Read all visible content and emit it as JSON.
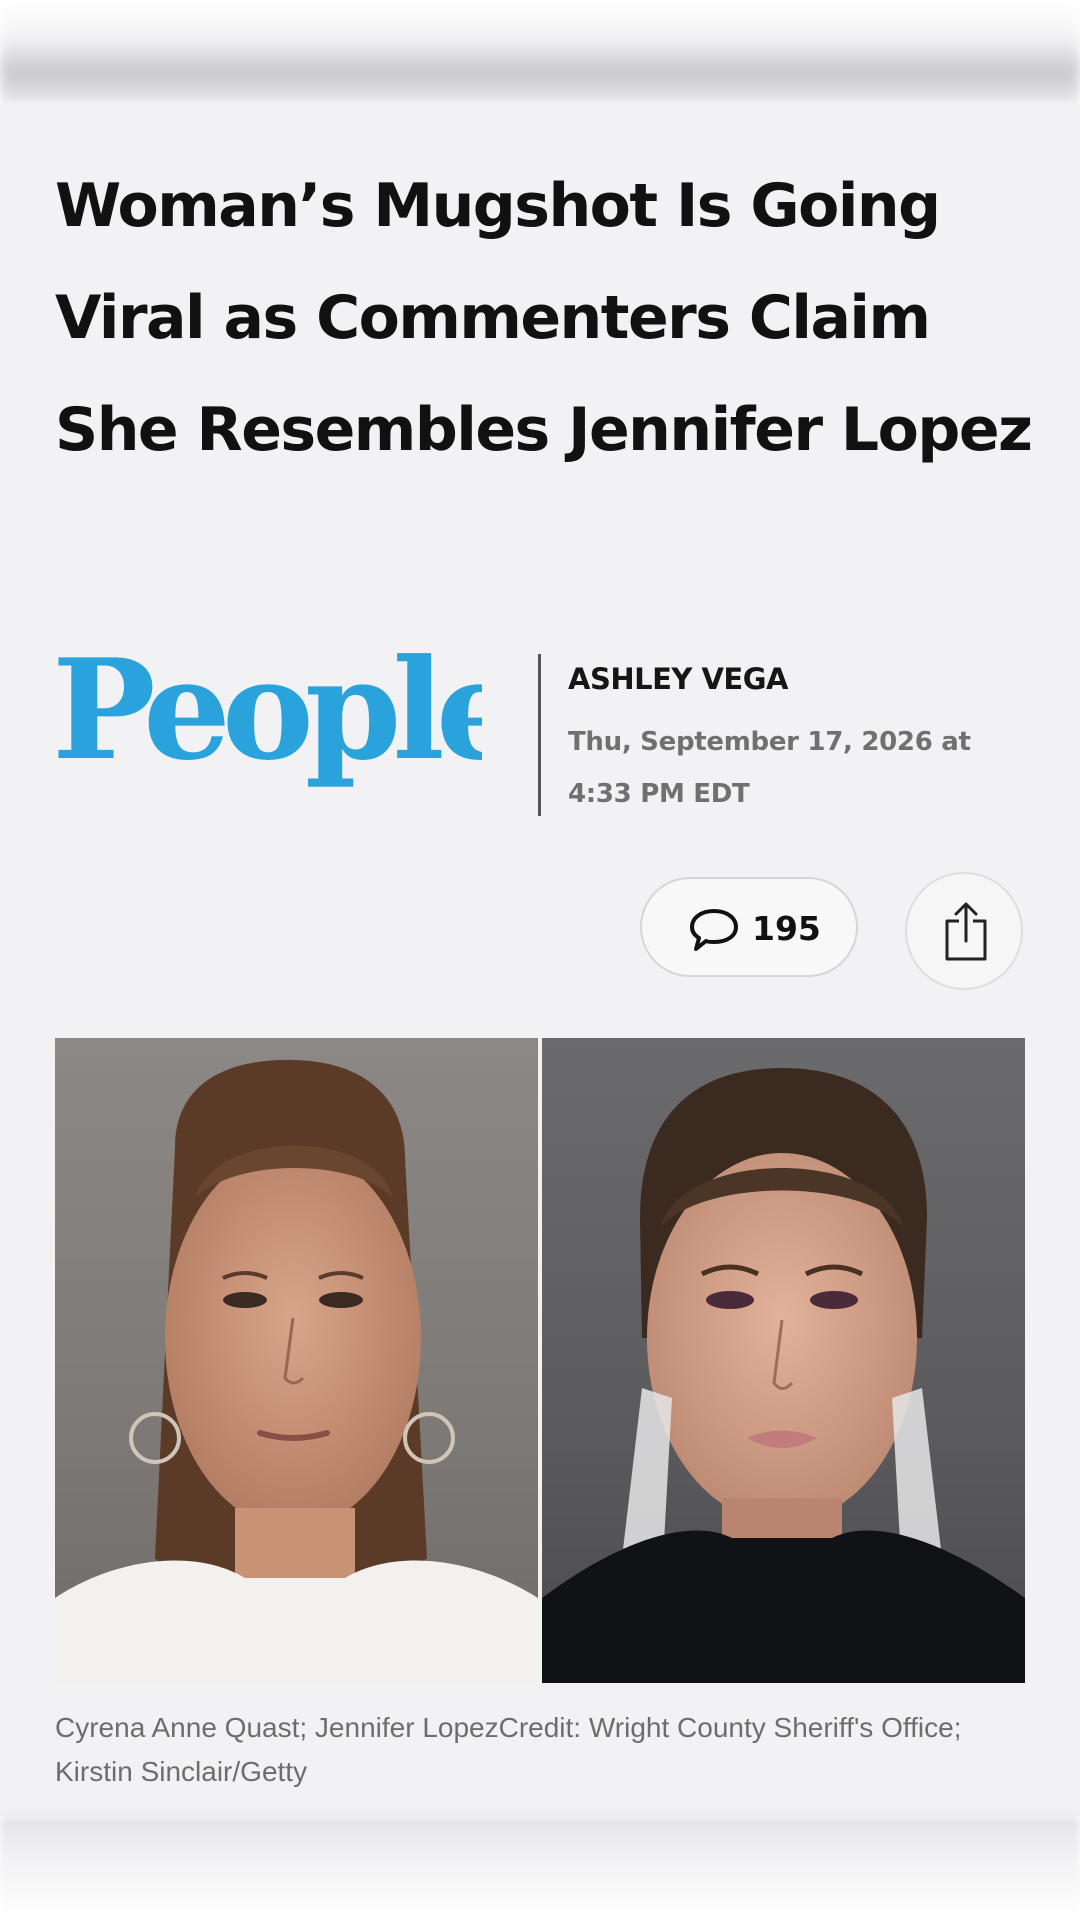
{
  "article": {
    "headline": "Woman’s Mugshot Is Going Viral as Commenters Claim She Resembles Jennifer Lopez",
    "publisher_logo_text": "People",
    "author": "ASHLEY VEGA",
    "date": "Thu, September 17, 2026 at 4:33 PM EDT",
    "comment_count": "195",
    "image_caption": "Cyrena Anne Quast; Jennifer LopezCredit: Wright County Sheriff's Office; Kirstin Sinclair/Getty"
  },
  "icons": {
    "comments": "speech-bubble-icon",
    "share": "share-upload-icon"
  },
  "colors": {
    "headline": "#111111",
    "logo": "#2aa3dc",
    "meta_text": "#707070",
    "card_background": "#f2f2f4"
  }
}
